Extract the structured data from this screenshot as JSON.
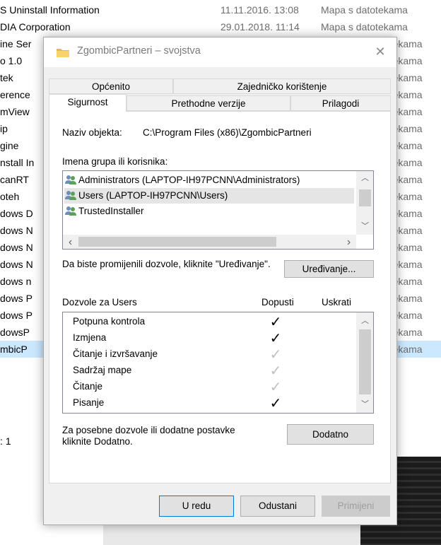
{
  "background": {
    "rows": [
      {
        "name": "S Uninstall Information",
        "date": "11.11.2016. 13:08",
        "type": "Mapa s datotekama"
      },
      {
        "name": "DIA Corporation",
        "date": "29.01.2018. 11:14",
        "type": "Mapa s datotekama"
      },
      {
        "name": "ine Ser",
        "right": "totekama"
      },
      {
        "name": "o 1.0",
        "right": "totekama"
      },
      {
        "name": "tek",
        "right": "totekama"
      },
      {
        "name": "erence",
        "right": "totekama"
      },
      {
        "name": "mView",
        "right": "totekama"
      },
      {
        "name": "ip",
        "right": "totekama"
      },
      {
        "name": "gine",
        "right": "totekama"
      },
      {
        "name": "nstall In",
        "right": "totekama"
      },
      {
        "name": "canRT",
        "right": "totekama"
      },
      {
        "name": "oteh",
        "right": "totekama"
      },
      {
        "name": "dows D",
        "right": "totekama"
      },
      {
        "name": "dows N",
        "right": "totekama"
      },
      {
        "name": "dows N",
        "right": "totekama"
      },
      {
        "name": "dows N",
        "right": "totekama"
      },
      {
        "name": "dows n",
        "right": "totekama"
      },
      {
        "name": "dows P",
        "right": "totekama"
      },
      {
        "name": "dows P",
        "right": "totekama"
      },
      {
        "name": "dowsP",
        "right": "totekama"
      },
      {
        "name": "mbicP",
        "right": "totekama",
        "selected": true
      }
    ],
    "status": ": 1"
  },
  "dialog": {
    "title": "ZgombicPartneri – svojstva",
    "close_glyph": "✕",
    "tabs_row1": [
      "Općenito",
      "Zajedničko korištenje"
    ],
    "tabs_row2": [
      "Sigurnost",
      "Prethodne verzije",
      "Prilagodi"
    ],
    "object_label": "Naziv objekta:",
    "object_path": "C:\\Program Files (x86)\\ZgombicPartneri",
    "groups_label": "Imena grupa ili korisnika:",
    "groups": [
      {
        "name": "Administrators (LAPTOP-IH97PCNN\\Administrators)"
      },
      {
        "name": "Users (LAPTOP-IH97PCNN\\Users)",
        "selected": true
      },
      {
        "name": "TrustedInstaller"
      }
    ],
    "edit_hint": "Da biste promijenili dozvole, kliknite \"Uređivanje\".",
    "edit_button": "Uređivanje...",
    "perm_header": "Dozvole za Users",
    "allow_header": "Dopusti",
    "deny_header": "Uskrati",
    "permissions": [
      {
        "name": "Potpuna kontrola",
        "allow": "dark"
      },
      {
        "name": "Izmjena",
        "allow": "dark"
      },
      {
        "name": "Čitanje i izvršavanje",
        "allow": "light"
      },
      {
        "name": "Sadržaj mape",
        "allow": "light"
      },
      {
        "name": "Čitanje",
        "allow": "light"
      },
      {
        "name": "Pisanje",
        "allow": "dark"
      }
    ],
    "advanced_hint": "Za posebne dozvole ili dodatne postavke kliknite Dodatno.",
    "advanced_button": "Dodatno",
    "ok_button": "U redu",
    "cancel_button": "Odustani",
    "apply_button": "Primijeni",
    "check_glyph": "✓",
    "colors": {
      "dialog_bg": "#f0f0f0",
      "selection": "#cce8ff",
      "folder": "#e8b949"
    }
  }
}
